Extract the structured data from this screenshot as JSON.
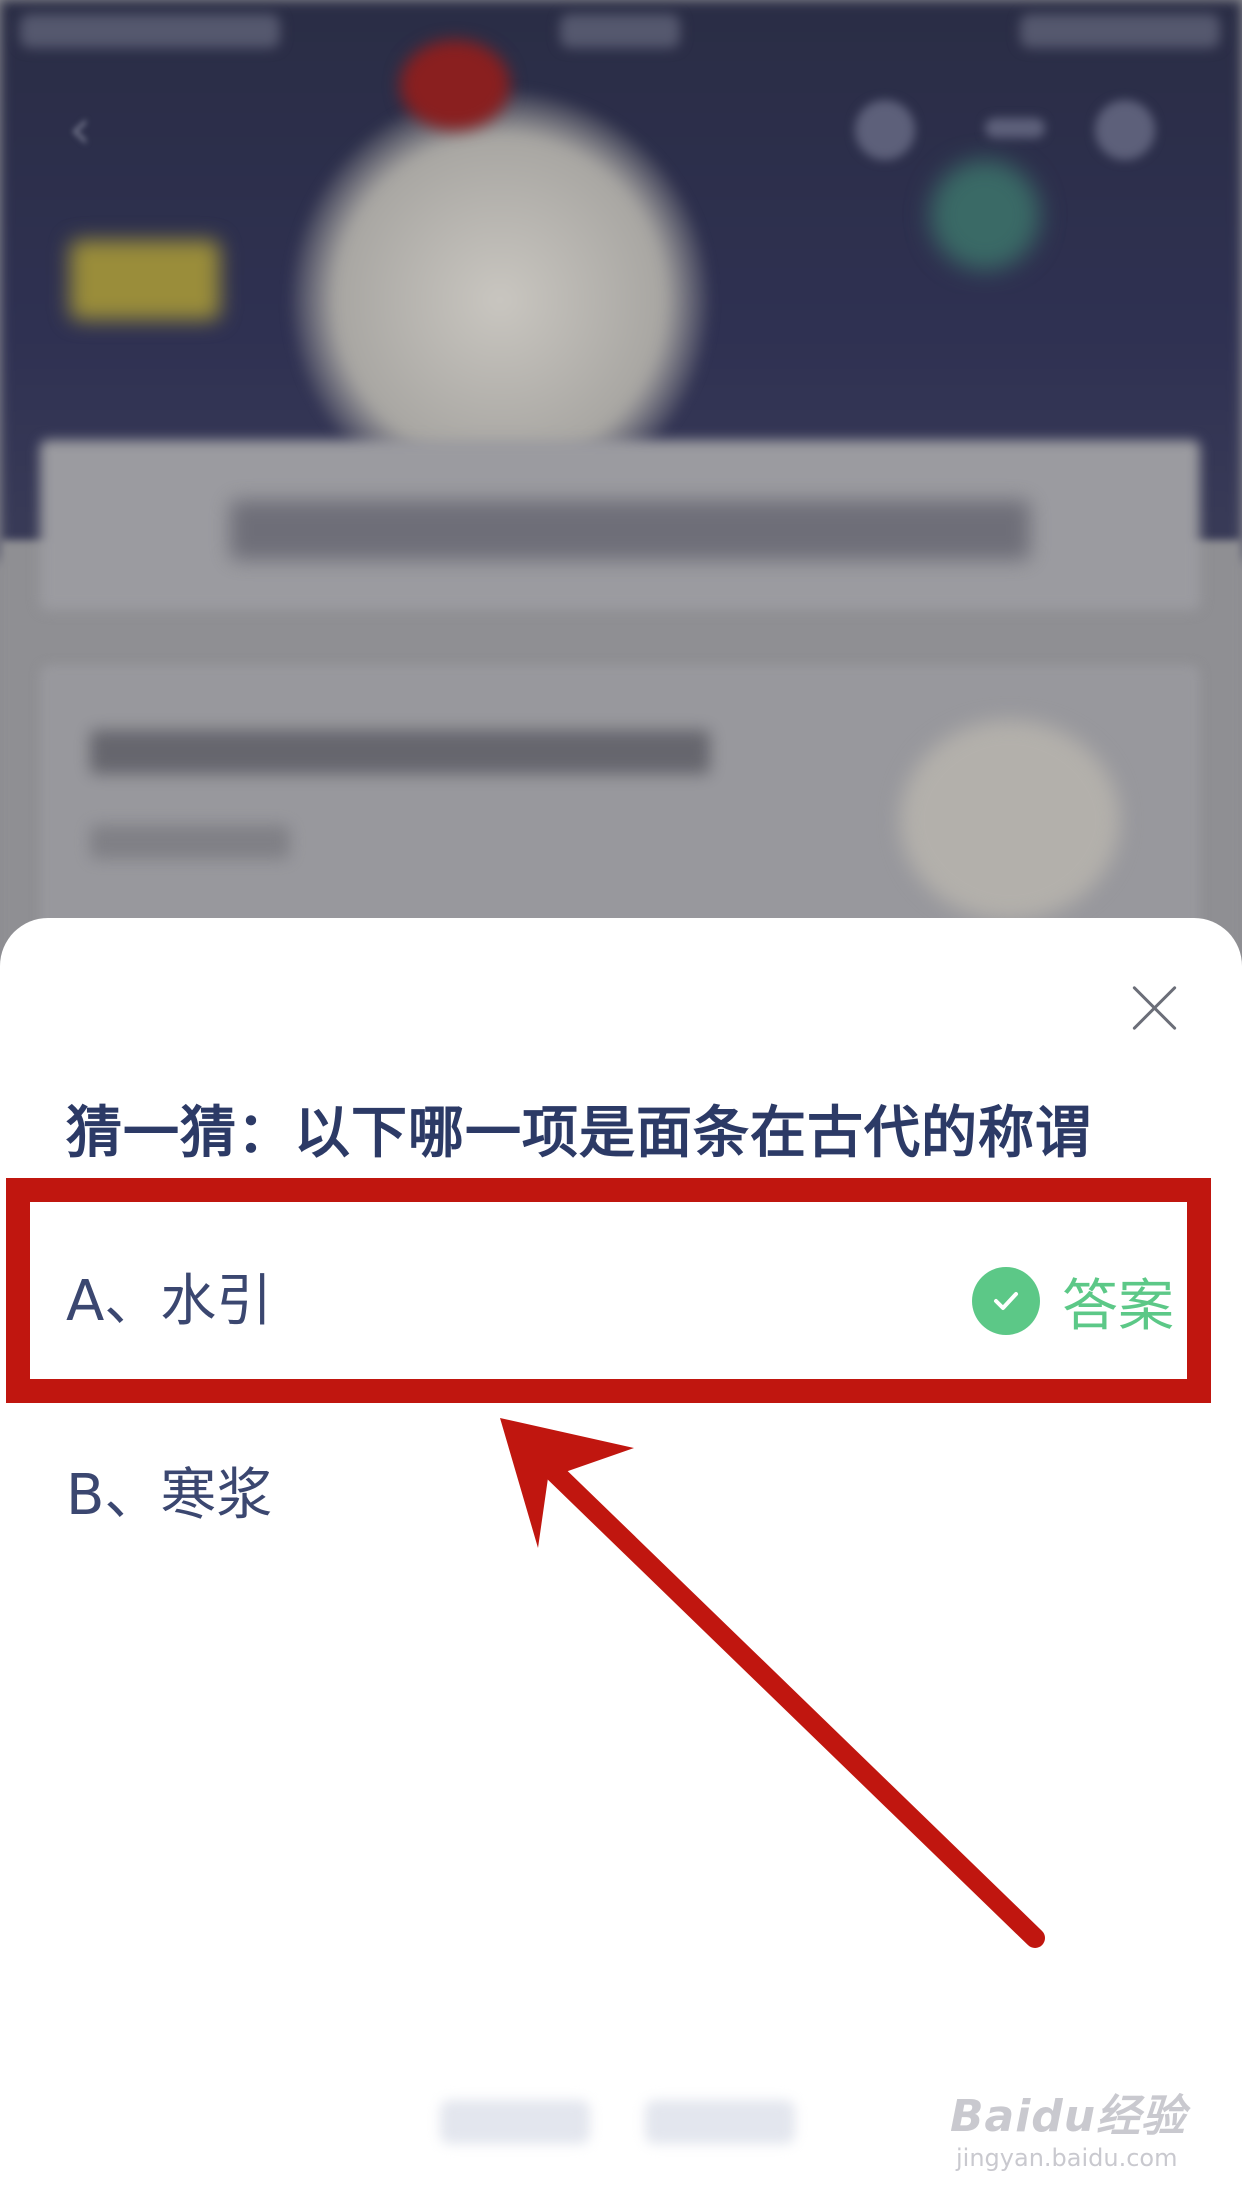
{
  "sheet": {
    "question": "猜一猜：以下哪一项是面条在古代的称谓",
    "options": [
      {
        "label": "A、水引"
      },
      {
        "label": "B、寒浆"
      }
    ],
    "answer_tag": "答案"
  },
  "colors": {
    "highlight": "#c0160f",
    "answer_green": "#5cc887",
    "title_navy": "#2c3a66"
  },
  "icons": [
    "close-icon",
    "check-icon",
    "arrow-annotation"
  ],
  "watermark": {
    "logo": "Baidu经验",
    "url": "jingyan.baidu.com"
  }
}
